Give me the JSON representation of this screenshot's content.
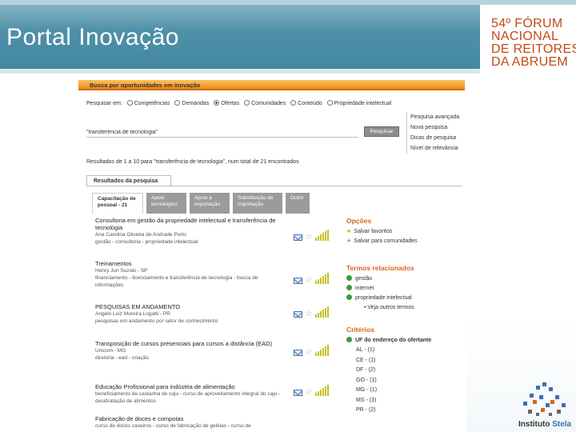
{
  "slide": {
    "title": "Portal Inovação",
    "logo_lines": [
      "54º FÓRUM",
      "NACIONAL",
      "DE REITORES",
      "DA ABRUEM"
    ]
  },
  "portal": {
    "bar_title": "Busca por oportunidades em inovação",
    "search_in_label": "Pesquisar em:",
    "search_options": [
      "Competências",
      "Demandas",
      "Ofertas",
      "Comunidades",
      "Conteúdo",
      "Propriedade intelectual"
    ],
    "query_value": "\"transferência de tecnologia\"",
    "search_button": "Pesquisar",
    "side_links": [
      "Pesquisa avançada",
      "Nova pesquisa",
      "Dicas de pesquisa",
      "Nível de relevância"
    ],
    "results_count": "Resultados de 1 a 10 para \"transferência de tecnologia\", num total de 21 encontrados",
    "results_tab": "Resultados da pesquisa",
    "categories": [
      {
        "line1": "Capacitação de",
        "line2": "pessoal - 21"
      },
      {
        "line1": "Apoio",
        "line2": "tecnológico"
      },
      {
        "line1": "Apoio à",
        "line2": "exportação"
      },
      {
        "line1": "Substituição de",
        "line2": "importação"
      },
      {
        "line1": "Outro",
        "line2": ""
      }
    ],
    "results": [
      {
        "title": "Consultoria em gestão da propriedade intelectual e transferência de tecnologia",
        "author": "Ana Carolina Oliveira de Andrade Porto",
        "tags": "gestão - consultoria - propriedade intelectual"
      },
      {
        "title": "Treinamentos",
        "author": "Henry Jun Suzuki - SP",
        "tags": "financiamento - licenciamento e transferência de tecnologia - busca de informações"
      },
      {
        "title": "PESQUISAS EM ANDAMENTO",
        "author": "Angelo Luiz Moreira Logatti - PR",
        "tags": "pesquisas em andamento por setor de conhecimento"
      },
      {
        "title": "Transposição de cursos presenciais para cursos a distância (EAD)",
        "author": "Unicom - MG",
        "tags": "diretoria - ead - criação"
      },
      {
        "title": "Educação Profissional para indústria de alimentação",
        "author": "",
        "tags": "beneficiamento de castanha de caju - curso de aproveitamento integral do caju - desidratação de alimentos"
      },
      {
        "title": "Fabricação de doces e compotas",
        "author": "",
        "tags": "curso de doces caseiros - curso de fabricação de geléias - curso de"
      }
    ],
    "options_heading": "Opções",
    "options": [
      "Salvar favoritos",
      "Salvar para comunidades"
    ],
    "related_heading": "Termos relacionados",
    "related_terms": [
      "gestão",
      "internet",
      "propriedade intelectual"
    ],
    "more_terms": "• Veja outros termos",
    "criteria_heading": "Critérios",
    "criteria_sub": "UF do endereço do ofertante",
    "criteria_items": [
      "AL - (1)",
      "CE - (1)",
      "DF - (2)",
      "GO - (1)",
      "MG - (1)",
      "MS - (3)",
      "PR - (2)"
    ]
  },
  "brand": {
    "stela_a": "Instituto",
    "stela_b": "Stela"
  }
}
